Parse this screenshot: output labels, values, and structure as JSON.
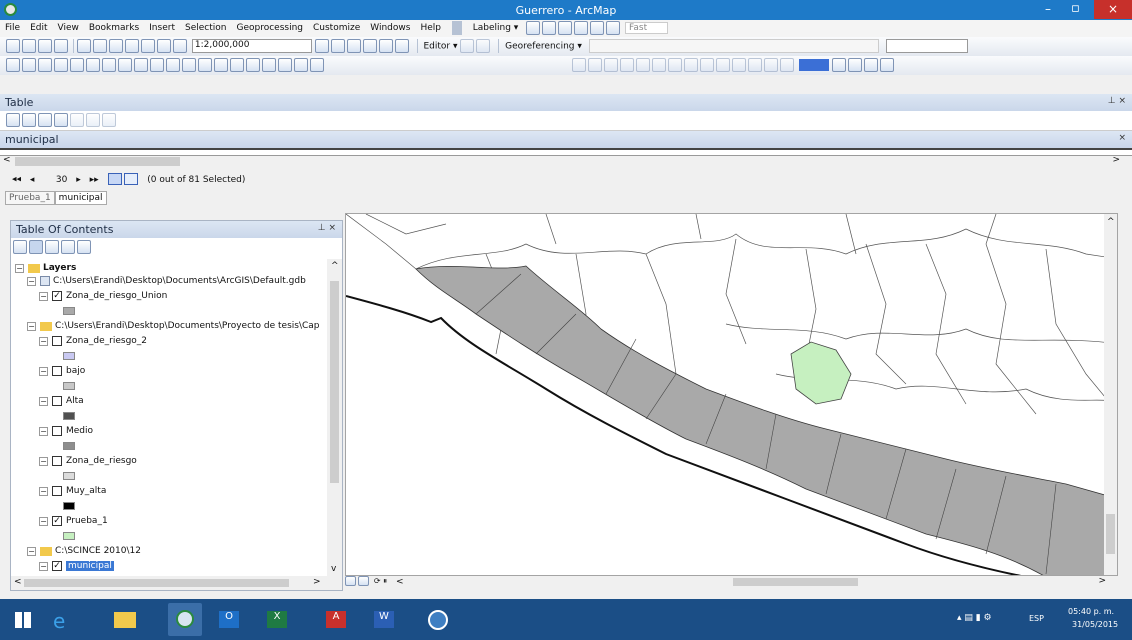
{
  "window": {
    "title": "Guerrero - ArcMap",
    "minimize": "–",
    "maximize": "▫",
    "close": "×"
  },
  "menu": [
    "File",
    "Edit",
    "View",
    "Bookmarks",
    "Insert",
    "Selection",
    "Geoprocessing",
    "Customize",
    "Windows",
    "Help"
  ],
  "labeling": {
    "label": "Labeling ▾",
    "fast": "Fast"
  },
  "toolbar": {
    "scale": "1:2,000,000",
    "editor": "Editor ▾",
    "georeferencing": "Georeferencing ▾"
  },
  "table": {
    "title": "Table",
    "tab_title": "municipal",
    "page": "30",
    "selected": "(0 out of 81 Selected)",
    "tabs": [
      "Prueba_1",
      "municipal"
    ]
  },
  "toc": {
    "title": "Table Of Contents",
    "layers_root": "Layers",
    "gdb_path": "C:\\Users\\Erandi\\Desktop\\Documents\\ArcGIS\\Default.gdb",
    "zona_union": "Zona_de_riesgo_Union",
    "folder_path": "C:\\Users\\Erandi\\Desktop\\Documents\\Proyecto de tesis\\Cap",
    "zona2": "Zona_de_riesgo_2",
    "bajo": "bajo",
    "alta": "Alta",
    "medio": "Medio",
    "zona": "Zona_de_riesgo",
    "muy_alta": "Muy_alta",
    "prueba": "Prueba_1",
    "scince": "C:\\SCINCE 2010\\12",
    "municipal": "municipal"
  },
  "colors": {
    "land_gray": "#a9a9a9",
    "highlight_green": "#c6f0c0",
    "accent": "#1e7ac8",
    "taskbar": "#1b4e86"
  },
  "tray": {
    "lang": "ESP",
    "time": "05:40 p. m.",
    "date": "31/05/2015"
  }
}
